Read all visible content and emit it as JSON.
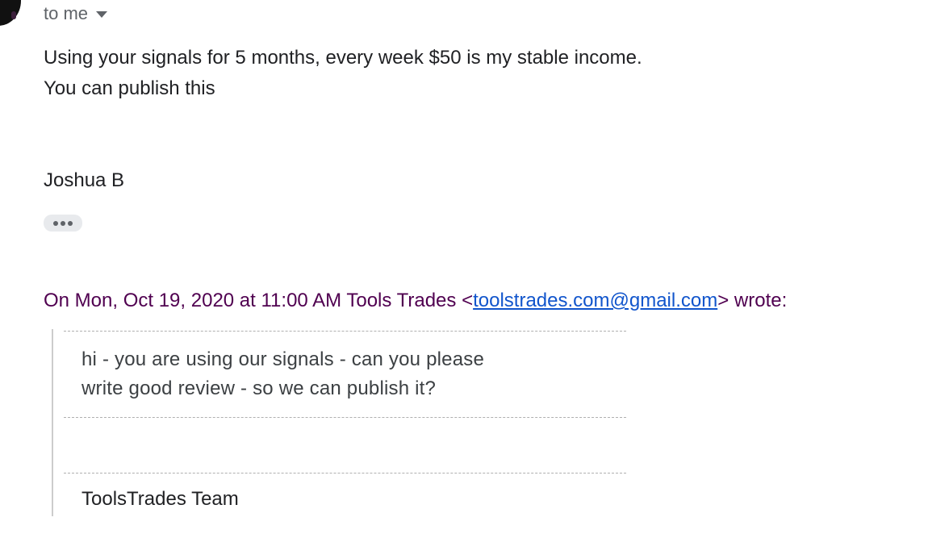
{
  "header": {
    "recipient_label": "to me"
  },
  "message": {
    "lines": [
      "Using your signals for 5 months, every week $50 is my stable income.",
      "You can publish this"
    ],
    "signature": "Joshua B"
  },
  "quoted": {
    "attribution_prefix": "On Mon, Oct 19, 2020 at 11:00 AM Tools Trades <",
    "sender_email": "toolstrades.com@gmail.com",
    "attribution_suffix": "> wrote:",
    "lines": [
      "hi - you are using our signals - can you please",
      "write good review - so we can publish it?"
    ],
    "signature": "ToolsTrades Team"
  },
  "icons": {
    "recipient_caret": "caret-down-icon",
    "show_trimmed": "ellipsis-icon"
  },
  "colors": {
    "attribution": "#500050",
    "link": "#1155cc",
    "pill": "#e8eaed"
  }
}
